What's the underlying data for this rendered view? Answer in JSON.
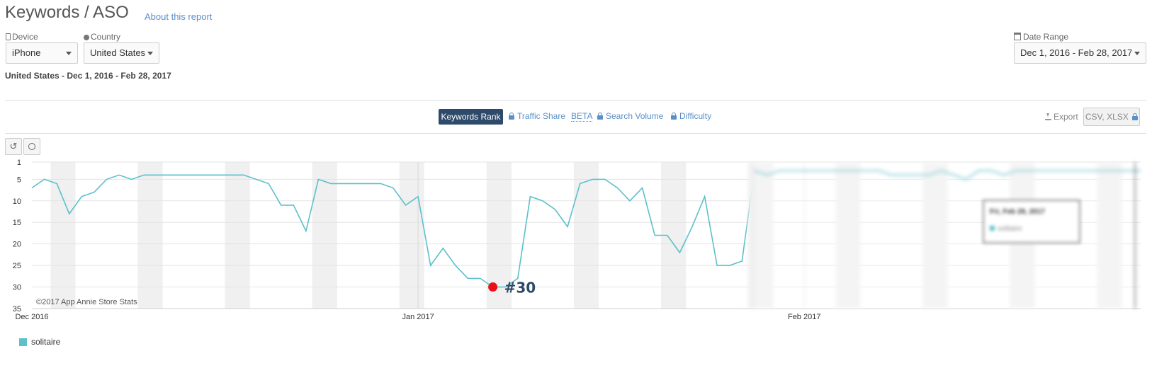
{
  "header": {
    "title": "Keywords / ASO",
    "about_link": "About this report"
  },
  "filters": {
    "device": {
      "label": "Device",
      "value": "iPhone"
    },
    "country": {
      "label": "Country",
      "value": "United States"
    },
    "date_range": {
      "label": "Date Range",
      "value": "Dec 1, 2016 - Feb 28, 2017"
    }
  },
  "subtitle": "United States - Dec 1, 2016 - Feb 28, 2017",
  "tabs": [
    {
      "label": "Keywords Rank",
      "active": true,
      "locked": false
    },
    {
      "label": "Traffic Share",
      "active": false,
      "locked": true
    },
    {
      "label": "BETA",
      "active": false,
      "locked": false
    },
    {
      "label": "Search Volume",
      "active": false,
      "locked": true
    },
    {
      "label": "Difficulty",
      "active": false,
      "locked": true
    }
  ],
  "export": {
    "label": "Export",
    "formats": "CSV, XLSX"
  },
  "tooltip": {
    "date": "Fri, Feb 28, 2017",
    "series": "solitaire"
  },
  "annotation": {
    "label": "#30"
  },
  "copyright": "©2017 App Annie Store Stats",
  "colors": {
    "series": "#5bc0cc",
    "marker": "#e8111a",
    "weekend_band": "#f0f0f0"
  },
  "chart_data": {
    "type": "line",
    "y_reversed": true,
    "ylim": [
      1,
      35
    ],
    "y_ticks": [
      1,
      5,
      10,
      15,
      20,
      25,
      30,
      35
    ],
    "x_ticks": [
      "Dec 2016",
      "Jan 2017",
      "Feb 2017"
    ],
    "grid": true,
    "legend": "bottom-left",
    "series": [
      {
        "name": "solitaire",
        "x": [
          "2016-12-01",
          "2016-12-02",
          "2016-12-03",
          "2016-12-04",
          "2016-12-05",
          "2016-12-06",
          "2016-12-07",
          "2016-12-08",
          "2016-12-09",
          "2016-12-10",
          "2016-12-11",
          "2016-12-12",
          "2016-12-13",
          "2016-12-14",
          "2016-12-15",
          "2016-12-16",
          "2016-12-17",
          "2016-12-18",
          "2016-12-19",
          "2016-12-20",
          "2016-12-21",
          "2016-12-22",
          "2016-12-23",
          "2016-12-24",
          "2016-12-25",
          "2016-12-26",
          "2016-12-27",
          "2016-12-28",
          "2016-12-29",
          "2016-12-30",
          "2016-12-31",
          "2017-01-01",
          "2017-01-02",
          "2017-01-03",
          "2017-01-04",
          "2017-01-05",
          "2017-01-06",
          "2017-01-07",
          "2017-01-08",
          "2017-01-09",
          "2017-01-10",
          "2017-01-11",
          "2017-01-12",
          "2017-01-13",
          "2017-01-14",
          "2017-01-15",
          "2017-01-16",
          "2017-01-17",
          "2017-01-18",
          "2017-01-19",
          "2017-01-20",
          "2017-01-21",
          "2017-01-22",
          "2017-01-23",
          "2017-01-24",
          "2017-01-25",
          "2017-01-26",
          "2017-01-27",
          "2017-01-28",
          "2017-01-29",
          "2017-01-30",
          "2017-01-31",
          "2017-02-01",
          "2017-02-02",
          "2017-02-03",
          "2017-02-04",
          "2017-02-05",
          "2017-02-06",
          "2017-02-07",
          "2017-02-08",
          "2017-02-09",
          "2017-02-10",
          "2017-02-11",
          "2017-02-12",
          "2017-02-13",
          "2017-02-14",
          "2017-02-15",
          "2017-02-16",
          "2017-02-17",
          "2017-02-18",
          "2017-02-19",
          "2017-02-20",
          "2017-02-21",
          "2017-02-22",
          "2017-02-23",
          "2017-02-24",
          "2017-02-25",
          "2017-02-26",
          "2017-02-27",
          "2017-02-28"
        ],
        "values": [
          7,
          5,
          6,
          13,
          9,
          8,
          5,
          4,
          5,
          4,
          4,
          4,
          4,
          4,
          4,
          4,
          4,
          4,
          5,
          6,
          11,
          11,
          17,
          5,
          6,
          6,
          6,
          6,
          6,
          7,
          11,
          9,
          25,
          21,
          25,
          28,
          28,
          30,
          30,
          28,
          9,
          10,
          12,
          16,
          6,
          5,
          5,
          7,
          10,
          7,
          18,
          18,
          22,
          16,
          9,
          25,
          25,
          24,
          3,
          4,
          3,
          3,
          3,
          3,
          3,
          3,
          3,
          3,
          3,
          4,
          4,
          4,
          4,
          3,
          4,
          5,
          3,
          3,
          4,
          3,
          3,
          3,
          3,
          3,
          3,
          3,
          3,
          3,
          3,
          3
        ]
      }
    ],
    "highlight": {
      "x": "2017-01-07",
      "value": 30,
      "label": "#30"
    },
    "blurred_from": "2017-01-28"
  }
}
